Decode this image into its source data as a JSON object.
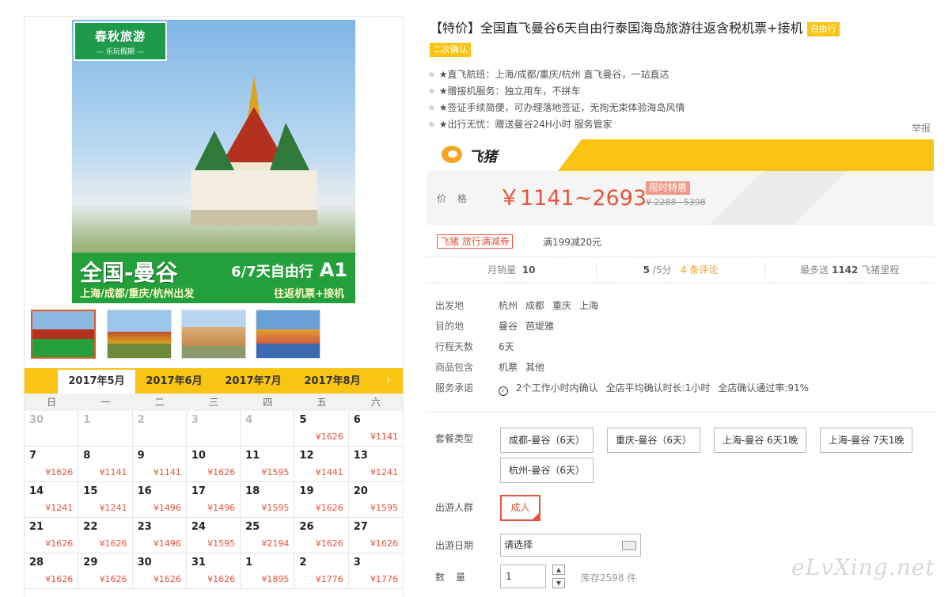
{
  "gallery": {
    "logo_title": "春秋旅游",
    "logo_sub": "— 乐玩假期 —",
    "band_title": "全国-曼谷",
    "band_days": "6/7天自由行",
    "band_code": "A1",
    "band_from": "上海/成都/重庆/杭州出发",
    "band_ticket": "往返机票+接机"
  },
  "calendar": {
    "months": [
      "2017年5月",
      "2017年6月",
      "2017年7月",
      "2017年8月"
    ],
    "next_arrow": "›",
    "weekdays": [
      "日",
      "一",
      "二",
      "三",
      "四",
      "五",
      "六"
    ],
    "cells": [
      {
        "day": "30",
        "price": "",
        "muted": true
      },
      {
        "day": "1",
        "price": "",
        "muted": true
      },
      {
        "day": "2",
        "price": "",
        "muted": true
      },
      {
        "day": "3",
        "price": "",
        "muted": true
      },
      {
        "day": "4",
        "price": "",
        "muted": true
      },
      {
        "day": "5",
        "price": "¥1626"
      },
      {
        "day": "6",
        "price": "¥1141"
      },
      {
        "day": "7",
        "price": "¥1626"
      },
      {
        "day": "8",
        "price": "¥1141"
      },
      {
        "day": "9",
        "price": "¥1141"
      },
      {
        "day": "10",
        "price": "¥1626"
      },
      {
        "day": "11",
        "price": "¥1595"
      },
      {
        "day": "12",
        "price": "¥1441"
      },
      {
        "day": "13",
        "price": "¥1241"
      },
      {
        "day": "14",
        "price": "¥1241"
      },
      {
        "day": "15",
        "price": "¥1241"
      },
      {
        "day": "16",
        "price": "¥1496"
      },
      {
        "day": "17",
        "price": "¥1496"
      },
      {
        "day": "18",
        "price": "¥1595"
      },
      {
        "day": "19",
        "price": "¥1626"
      },
      {
        "day": "20",
        "price": "¥1595"
      },
      {
        "day": "21",
        "price": "¥1626"
      },
      {
        "day": "22",
        "price": "¥1626"
      },
      {
        "day": "23",
        "price": "¥1496"
      },
      {
        "day": "24",
        "price": "¥1595"
      },
      {
        "day": "25",
        "price": "¥2194"
      },
      {
        "day": "26",
        "price": "¥1626"
      },
      {
        "day": "27",
        "price": "¥1626"
      },
      {
        "day": "28",
        "price": "¥1626"
      },
      {
        "day": "29",
        "price": "¥1626"
      },
      {
        "day": "30",
        "price": "¥1626"
      },
      {
        "day": "31",
        "price": "¥1626"
      },
      {
        "day": "1",
        "price": "¥1895"
      },
      {
        "day": "2",
        "price": "¥1776"
      },
      {
        "day": "3",
        "price": "¥1776"
      }
    ]
  },
  "product": {
    "title": "【特价】全国直飞曼谷6天自由行泰国海岛旅游往返含税机票+接机",
    "tag_free": "自由行",
    "tag_confirm": "二次确认",
    "features": [
      "★直飞航班：上海/成都/重庆/杭州 直飞曼谷，一站直达",
      "★赠接机服务：独立用车，不拼车",
      "★签证手续简便，可办理落地签证，无拘无束体验海岛风情",
      "★出行无忧：赠送曼谷24H小时 服务管家"
    ],
    "report": "举报",
    "brand": "飞猪",
    "price_label": "价格",
    "price": "￥1141~2693",
    "limited": "限时特惠",
    "orig_price": "¥ 2288~5398",
    "coupon": "飞猪 旅行满减券",
    "coupon_desc": "满199减20元",
    "stats": {
      "sales_label": "月销量",
      "sales_value": "10",
      "rating_value": "5",
      "rating_suffix": "/5分",
      "reviews": "4 条评论",
      "miles_prefix": "最多送",
      "miles_value": "1142",
      "miles_suffix": "飞猪里程"
    },
    "info": {
      "depart_label": "出发地",
      "depart": [
        "杭州",
        "成都",
        "重庆",
        "上海"
      ],
      "dest_label": "目的地",
      "dest": [
        "曼谷",
        "芭堤雅"
      ],
      "days_label": "行程天数",
      "days": "6天",
      "includes_label": "商品包含",
      "includes": [
        "机票",
        "其他"
      ],
      "service_label": "服务承诺",
      "service_1": "2个工作小时内确认",
      "service_2": "全店平均确认时长:1小时",
      "service_3": "全店确认通过率:91%"
    },
    "options": {
      "package_label": "套餐类型",
      "packages": [
        "成都-曼谷（6天）",
        "重庆-曼谷（6天）",
        "上海-曼谷 6天1晚",
        "上海-曼谷 7天1晚",
        "杭州-曼谷（6天）"
      ],
      "people_label": "出游人群",
      "people": "成人",
      "date_label": "出游日期",
      "date_placeholder": "请选择",
      "qty_label": "数量",
      "qty": "1",
      "stock": "库存2598 件"
    }
  },
  "watermark": "eLvXing.net"
}
